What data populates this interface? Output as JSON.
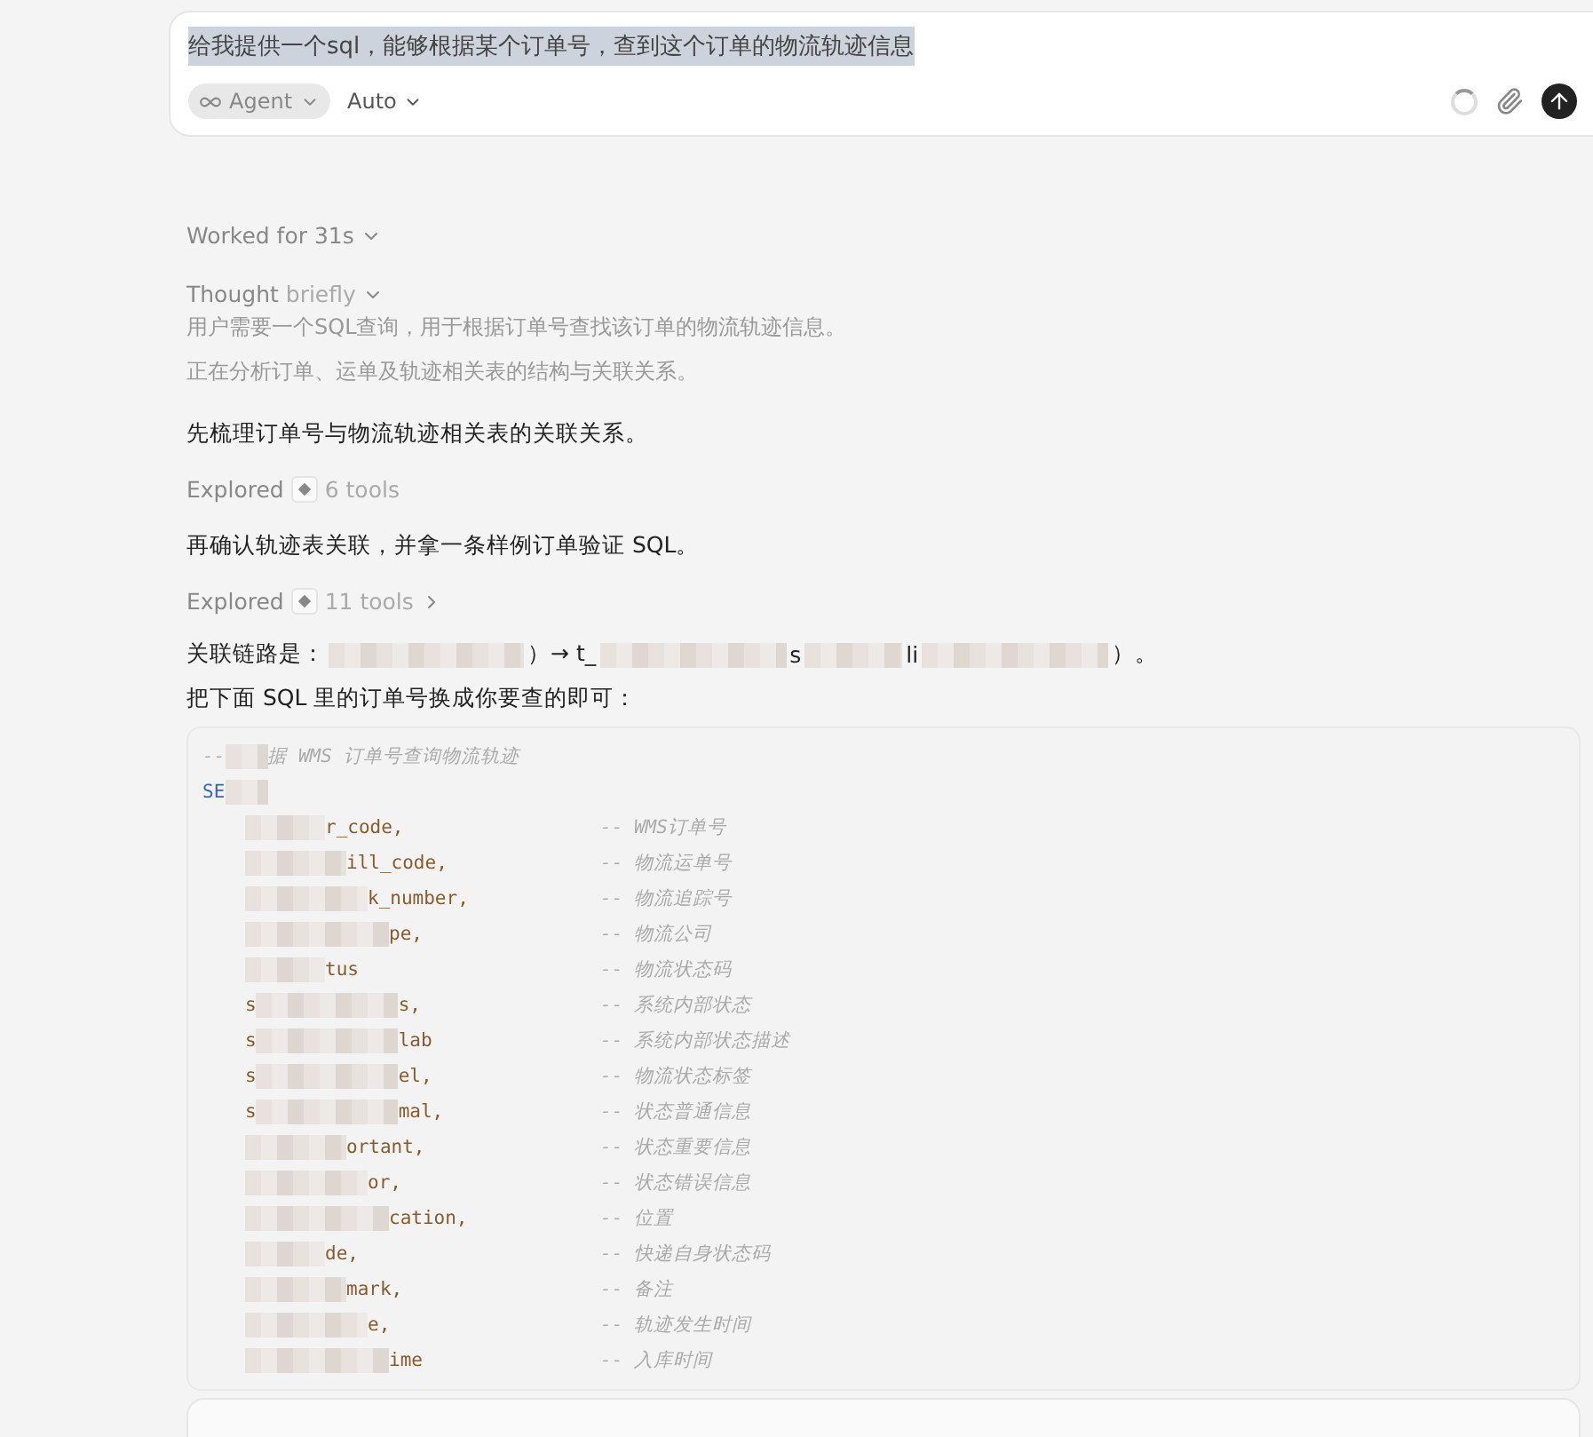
{
  "composer": {
    "value": "给我提供一个sql，能够根据某个订单号，查到这个订单的物流轨迹信息",
    "text_selected": true,
    "mode": "Agent",
    "model": "Auto",
    "busy": true
  },
  "worked": "Worked for 31s",
  "thought": {
    "label": "Thought",
    "detail": "briefly",
    "lines": [
      "用户需要一个SQL查询，用于根据订单号查找该订单的物流轨迹信息。",
      "正在分析订单、运单及轨迹相关表的结构与关联关系。"
    ]
  },
  "steps": [
    {
      "kind": "text",
      "text": "先梳理订单号与物流轨迹相关表的关联关系。"
    },
    {
      "kind": "explored",
      "label": "Explored",
      "count": "6 tools",
      "expandable": false
    },
    {
      "kind": "text",
      "text": "再确认轨迹表关联，并拿一条样例订单验证 SQL。"
    },
    {
      "kind": "explored",
      "label": "Explored",
      "count": "11 tools",
      "expandable": true
    }
  ],
  "chain": [
    "关联链路是：",
    "）→ t_",
    "s",
    "li",
    "）。"
  ],
  "instruction": "把下面 SQL 里的订单号换成你要查的即可：",
  "code": {
    "header": [
      "--",
      "据 WMS 订单号查询物流轨迹"
    ],
    "keyword": "SE",
    "lines": [
      {
        "fragment": "r_code,",
        "comment": "-- WMS订单号"
      },
      {
        "fragment": "ill_code,",
        "comment": "-- 物流运单号"
      },
      {
        "fragment": "k_number,",
        "comment": "-- 物流追踪号"
      },
      {
        "fragment": "pe,",
        "comment": "-- 物流公司"
      },
      {
        "fragment": "tus",
        "comment": "-- 物流状态码"
      },
      {
        "prefix": "s",
        "fragment": "s,",
        "comment": "-- 系统内部状态"
      },
      {
        "prefix": "s",
        "fragment": "lab",
        "comment": "-- 系统内部状态描述"
      },
      {
        "prefix": "s",
        "fragment": "el,",
        "comment": "-- 物流状态标签"
      },
      {
        "prefix": "s",
        "fragment": "mal,",
        "comment": "-- 状态普通信息"
      },
      {
        "fragment": "ortant,",
        "comment": "-- 状态重要信息"
      },
      {
        "fragment": "or,",
        "comment": "-- 状态错误信息"
      },
      {
        "fragment": "cation,",
        "comment": "-- 位置"
      },
      {
        "fragment": "de,",
        "comment": "-- 快递自身状态码"
      },
      {
        "fragment": "mark,",
        "comment": "-- 备注"
      },
      {
        "fragment": "e,",
        "comment": "-- 轨迹发生时间"
      },
      {
        "fragment": "ime",
        "comment": "-- 入库时间"
      }
    ]
  }
}
